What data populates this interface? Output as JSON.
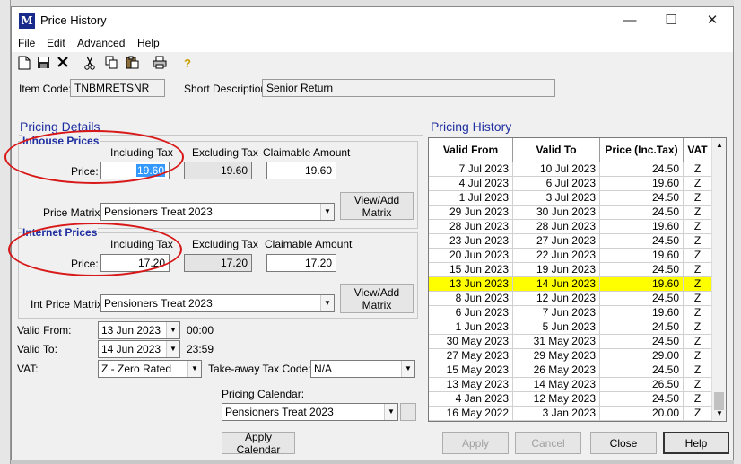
{
  "window": {
    "title": "Price History"
  },
  "menu": [
    "File",
    "Edit",
    "Advanced",
    "Help"
  ],
  "toolbar_icons": [
    "new-icon",
    "save-icon",
    "delete-icon",
    "cut-icon",
    "copy-icon",
    "paste-icon",
    "print-icon",
    "help-icon"
  ],
  "item": {
    "code_label": "Item Code:",
    "code_value": "TNBMRETSNR",
    "desc_label": "Short Description:",
    "desc_value": "Senior Return"
  },
  "pricing_details": {
    "title": "Pricing Details",
    "inhouse": {
      "title": "Inhouse Prices",
      "col_including": "Including Tax",
      "col_excluding": "Excluding Tax",
      "col_claimable": "Claimable Amount",
      "price_label": "Price:",
      "including": "19.60",
      "excluding": "19.60",
      "claimable": "19.60",
      "matrix_label": "Price Matrix:",
      "matrix_value": "Pensioners Treat 2023",
      "matrix_button": [
        "View/Add",
        "Matrix"
      ]
    },
    "internet": {
      "title": "Internet Prices",
      "col_including": "Including Tax",
      "col_excluding": "Excluding Tax",
      "col_claimable": "Claimable Amount",
      "price_label": "Price:",
      "including": "17.20",
      "excluding": "17.20",
      "claimable": "17.20",
      "matrix_label": "Int Price Matrix:",
      "matrix_value": "Pensioners Treat 2023",
      "matrix_button": [
        "View/Add",
        "Matrix"
      ]
    },
    "valid_from_label": "Valid From:",
    "valid_from_date": "13 Jun 2023",
    "valid_from_time": "00:00",
    "valid_to_label": "Valid To:",
    "valid_to_date": "14 Jun 2023",
    "valid_to_time": "23:59",
    "vat_label": "VAT:",
    "vat_value": "Z - Zero Rated",
    "takeaway_label": "Take-away Tax Code:",
    "takeaway_value": "N/A",
    "calendar_label": "Pricing Calendar:",
    "calendar_value": "Pensioners Treat 2023",
    "apply_calendar_button": "Apply Calendar"
  },
  "pricing_history": {
    "title": "Pricing History",
    "columns": [
      "Valid From",
      "Valid To",
      "Price (Inc.Tax)",
      "VAT"
    ],
    "rows": [
      [
        "7 Jul 2023",
        "10 Jul 2023",
        "24.50",
        "Z"
      ],
      [
        "4 Jul 2023",
        "6 Jul 2023",
        "19.60",
        "Z"
      ],
      [
        "1 Jul 2023",
        "3 Jul 2023",
        "24.50",
        "Z"
      ],
      [
        "29 Jun 2023",
        "30 Jun 2023",
        "24.50",
        "Z"
      ],
      [
        "28 Jun 2023",
        "28 Jun 2023",
        "19.60",
        "Z"
      ],
      [
        "23 Jun 2023",
        "27 Jun 2023",
        "24.50",
        "Z"
      ],
      [
        "20 Jun 2023",
        "22 Jun 2023",
        "19.60",
        "Z"
      ],
      [
        "15 Jun 2023",
        "19 Jun 2023",
        "24.50",
        "Z"
      ],
      [
        "13 Jun 2023",
        "14 Jun 2023",
        "19.60",
        "Z"
      ],
      [
        "8 Jun 2023",
        "12 Jun 2023",
        "24.50",
        "Z"
      ],
      [
        "6 Jun 2023",
        "7 Jun 2023",
        "19.60",
        "Z"
      ],
      [
        "1 Jun 2023",
        "5 Jun 2023",
        "24.50",
        "Z"
      ],
      [
        "30 May 2023",
        "31 May 2023",
        "24.50",
        "Z"
      ],
      [
        "27 May 2023",
        "29 May 2023",
        "29.00",
        "Z"
      ],
      [
        "15 May 2023",
        "26 May 2023",
        "24.50",
        "Z"
      ],
      [
        "13 May 2023",
        "14 May 2023",
        "26.50",
        "Z"
      ],
      [
        "4 Jan 2023",
        "12 May 2023",
        "24.50",
        "Z"
      ],
      [
        "16 May 2022",
        "3 Jan 2023",
        "20.00",
        "Z"
      ]
    ],
    "selected_row": 8,
    "highlight_color": "#ffff00"
  },
  "buttons": {
    "apply": "Apply",
    "cancel": "Cancel",
    "close": "Close",
    "help": "Help"
  }
}
